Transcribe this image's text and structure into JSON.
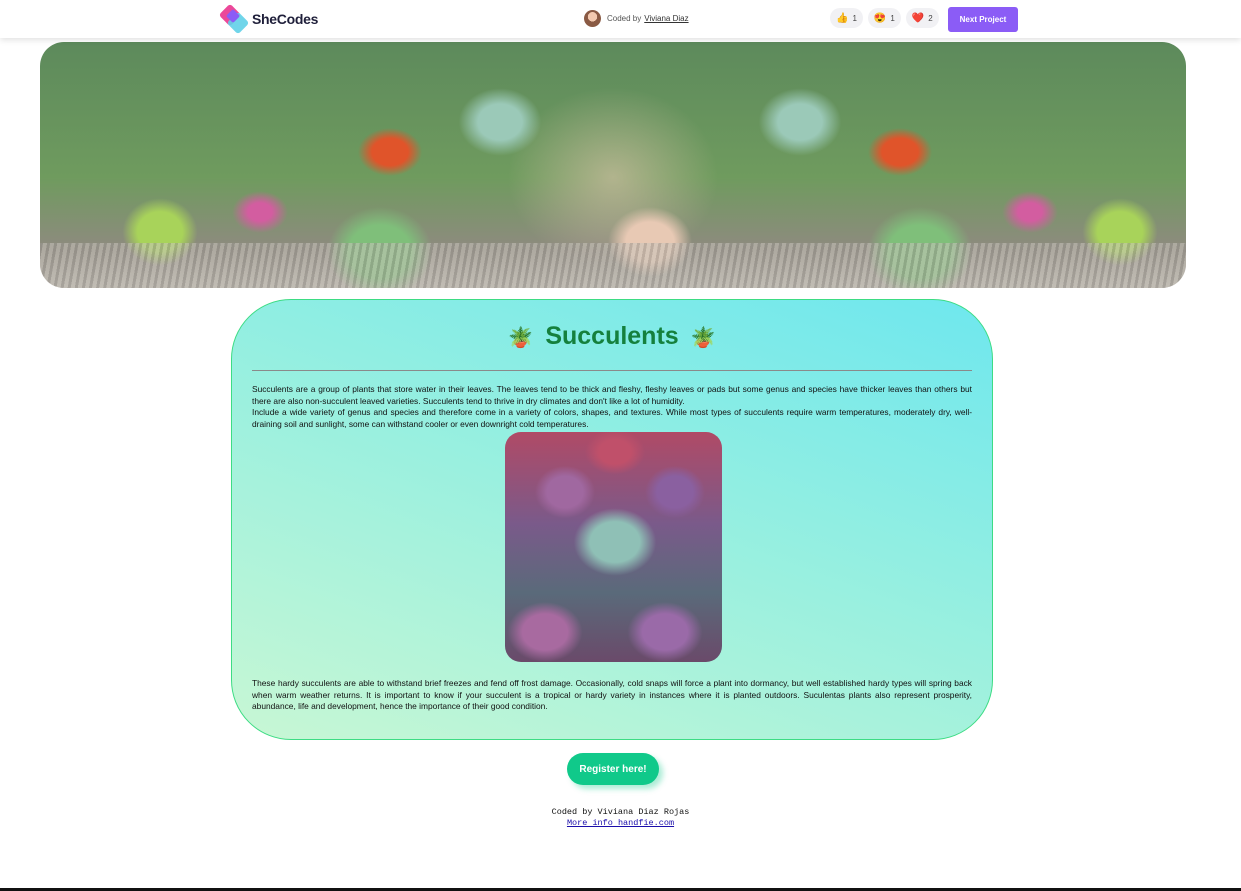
{
  "topbar": {
    "brand": "SheCodes",
    "coded_by_prefix": "Coded by",
    "coder_name": "Viviana Diaz",
    "reactions": [
      {
        "icon": "thumbs-up-icon",
        "glyph": "👍",
        "count": "1"
      },
      {
        "icon": "heart-eyes-icon",
        "glyph": "😍",
        "count": "1"
      },
      {
        "icon": "heart-icon",
        "glyph": "❤️",
        "count": "2"
      }
    ],
    "next_label": "Next Project"
  },
  "card": {
    "title": "Succulents",
    "title_icon": "🪴",
    "paragraph1_line1": "Succulents are a group of plants that store water in their leaves. The leaves tend to be thick and fleshy, fleshy leaves or pads but some genus and species have thicker leaves than others but there are also non-succulent leaved varieties. Succulents tend to thrive in dry climates and don't like a lot of humidity.",
    "paragraph1_line2": "Include a wide variety of genus and species and therefore come in a variety of colors, shapes, and textures. While most types of succulents require warm temperatures, moderately dry, well-draining soil and sunlight, some can withstand cooler or even downright cold temperatures.",
    "paragraph2": "These hardy succulents are able to withstand brief freezes and fend off frost damage. Occasionally, cold snaps will force a plant into dormancy, but well established hardy types will spring back when warm weather returns. It is important to know if your succulent is a tropical or hardy variety in instances where it is planted outdoors. Suculentas plants also represent prosperity, abundance, life and development, hence the importance of their good condition."
  },
  "register_label": "Register here!",
  "footer": {
    "credit": "Coded by Viviana Diaz Rojas",
    "link": "More info handfie.com"
  },
  "colors": {
    "accent": "#8b5cf6",
    "title_green": "#15803d",
    "register_green": "#10c98a"
  }
}
